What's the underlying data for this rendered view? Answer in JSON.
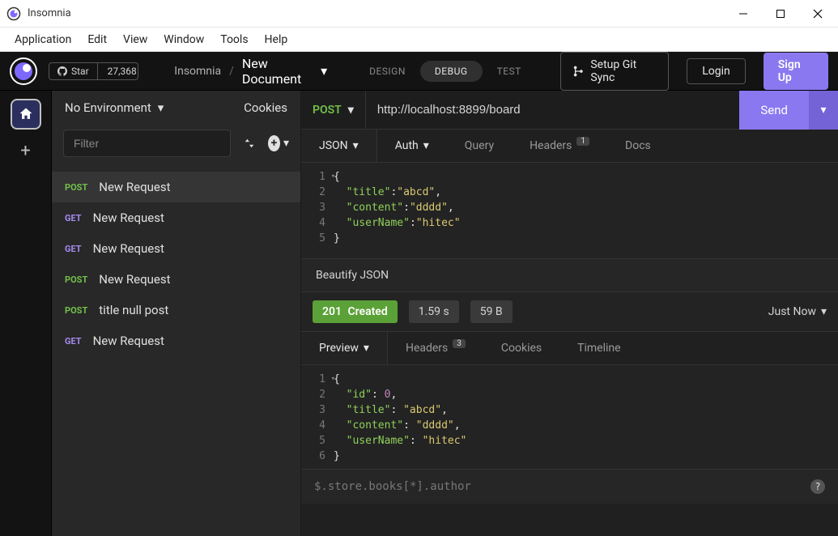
{
  "window": {
    "title": "Insomnia"
  },
  "menubar": [
    "Application",
    "Edit",
    "View",
    "Window",
    "Tools",
    "Help"
  ],
  "header": {
    "gh_label": "Star",
    "gh_count": "27,368",
    "crumb_root": "Insomnia",
    "crumb_doc": "New Document",
    "design": "DESIGN",
    "debug": "DEBUG",
    "test": "TEST",
    "git": "Setup Git Sync",
    "login": "Login",
    "signup": "Sign Up"
  },
  "sidebar": {
    "env_label": "No Environment",
    "cookies": "Cookies",
    "filter_placeholder": "Filter",
    "items": [
      {
        "method": "POST",
        "mcls": "m-post",
        "label": "New Request",
        "active": true
      },
      {
        "method": "GET",
        "mcls": "m-get",
        "label": "New Request"
      },
      {
        "method": "GET",
        "mcls": "m-get",
        "label": "New Request"
      },
      {
        "method": "POST",
        "mcls": "m-post",
        "label": "New Request"
      },
      {
        "method": "POST",
        "mcls": "m-post",
        "label": "title null post"
      },
      {
        "method": "GET",
        "mcls": "m-get",
        "label": "New Request"
      }
    ]
  },
  "request": {
    "method": "POST",
    "url": "http://localhost:8899/board",
    "send": "Send",
    "tabs": {
      "body": "JSON",
      "auth": "Auth",
      "query": "Query",
      "headers": "Headers",
      "headers_badge": "1",
      "docs": "Docs"
    },
    "body": {
      "lines": [
        "1",
        "2",
        "3",
        "4",
        "5"
      ],
      "kvs": [
        {
          "k": "title",
          "v": "abcd"
        },
        {
          "k": "content",
          "v": "dddd"
        },
        {
          "k": "userName",
          "v": "hitec"
        }
      ]
    },
    "beautify": "Beautify JSON"
  },
  "response": {
    "status_code": "201",
    "status_text": "Created",
    "time": "1.59 s",
    "size": "59 B",
    "timestamp": "Just Now",
    "tabs": {
      "preview": "Preview",
      "headers": "Headers",
      "headers_badge": "3",
      "cookies": "Cookies",
      "timeline": "Timeline"
    },
    "body": {
      "lines": [
        "1",
        "2",
        "3",
        "4",
        "5",
        "6"
      ],
      "kvs": [
        {
          "k": "id",
          "v": 0,
          "t": "num"
        },
        {
          "k": "title",
          "v": "abcd",
          "t": "str"
        },
        {
          "k": "content",
          "v": "dddd",
          "t": "str"
        },
        {
          "k": "userName",
          "v": "hitec",
          "t": "str"
        }
      ]
    },
    "jsonpath_placeholder": "$.store.books[*].author"
  }
}
